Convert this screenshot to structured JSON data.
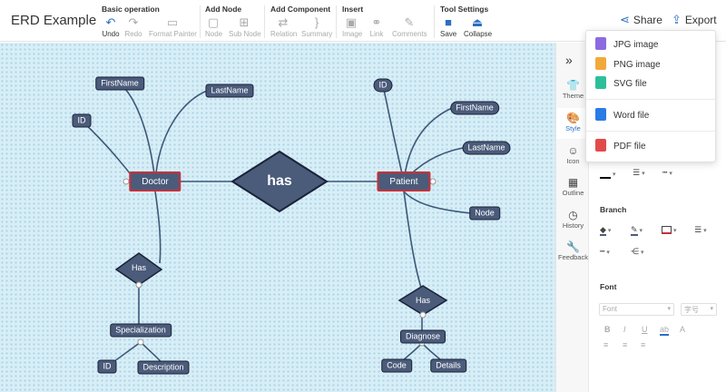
{
  "app": {
    "title": "ERD Example"
  },
  "toolbar": {
    "groups": [
      {
        "title": "Basic operation",
        "tools": [
          {
            "label": "Undo",
            "icon": "undo-icon",
            "glyph": "↶"
          },
          {
            "label": "Redo",
            "icon": "redo-icon",
            "glyph": "↷"
          },
          {
            "label": "Format Painter",
            "icon": "format-painter-icon",
            "glyph": "▭"
          }
        ]
      },
      {
        "title": "Add Node",
        "tools": [
          {
            "label": "Node",
            "icon": "node-icon",
            "glyph": "▢"
          },
          {
            "label": "Sub Node",
            "icon": "sub-node-icon",
            "glyph": "⊞"
          }
        ]
      },
      {
        "title": "Add Component",
        "tools": [
          {
            "label": "Relation",
            "icon": "relation-icon",
            "glyph": "⇄"
          },
          {
            "label": "Summary",
            "icon": "summary-icon",
            "glyph": "}"
          }
        ]
      },
      {
        "title": "Insert",
        "tools": [
          {
            "label": "Image",
            "icon": "image-icon",
            "glyph": "▣"
          },
          {
            "label": "Link",
            "icon": "link-icon",
            "glyph": "⚭"
          },
          {
            "label": "Comments",
            "icon": "comments-icon",
            "glyph": "✎"
          }
        ]
      },
      {
        "title": "Tool Settings",
        "tools": [
          {
            "label": "Save",
            "icon": "save-icon",
            "glyph": "■"
          },
          {
            "label": "Collapse",
            "icon": "collapse-icon",
            "glyph": "⏏"
          }
        ]
      }
    ],
    "share_label": "Share",
    "export_label": "Export"
  },
  "export_menu": {
    "items": [
      {
        "label": "JPG image",
        "icon": "jpg-file-icon",
        "color": "#8b6be0"
      },
      {
        "label": "PNG image",
        "icon": "png-file-icon",
        "color": "#f2a93b"
      },
      {
        "label": "SVG file",
        "icon": "svg-file-icon",
        "color": "#2cc09a"
      },
      {
        "label": "Word file",
        "icon": "word-file-icon",
        "color": "#2a7be4"
      },
      {
        "label": "PDF file",
        "icon": "pdf-file-icon",
        "color": "#e24a4a"
      }
    ]
  },
  "side_tabs": [
    {
      "label": "Theme",
      "icon": "theme-icon",
      "glyph": "👕"
    },
    {
      "label": "Style",
      "icon": "style-icon",
      "glyph": "🎨"
    },
    {
      "label": "Icon",
      "icon": "smiley-icon",
      "glyph": "☺"
    },
    {
      "label": "Outline",
      "icon": "outline-icon",
      "glyph": "▦"
    },
    {
      "label": "History",
      "icon": "history-icon",
      "glyph": "◷"
    },
    {
      "label": "Feedback",
      "icon": "feedback-icon",
      "glyph": "🔧"
    }
  ],
  "panel": {
    "branch_title": "Branch",
    "font_title": "Font",
    "font_placeholder": "Font",
    "size_placeholder": "字号"
  },
  "diagram": {
    "relationship_main": "has",
    "entities": {
      "left": "Doctor",
      "right": "Patient"
    },
    "doctor_attrs": {
      "first": "FirstName",
      "last": "LastName",
      "id": "ID"
    },
    "patient_attrs": {
      "id": "ID",
      "first": "FirstName",
      "last": "LastName",
      "node": "Node"
    },
    "left_rel": "Has",
    "right_rel": "Has",
    "specialization": {
      "name": "Specialization",
      "id": "ID",
      "desc": "Description"
    },
    "diagnose": {
      "name": "Diagnose",
      "code": "Code",
      "details": "Details"
    }
  },
  "colors": {
    "node_fill": "#4b5b7a",
    "node_border": "#1a2238",
    "entity_border": "#c93038",
    "connector": "#3d5878",
    "canvas_bg": "#d8eef7",
    "accent": "#2a6fc4"
  }
}
